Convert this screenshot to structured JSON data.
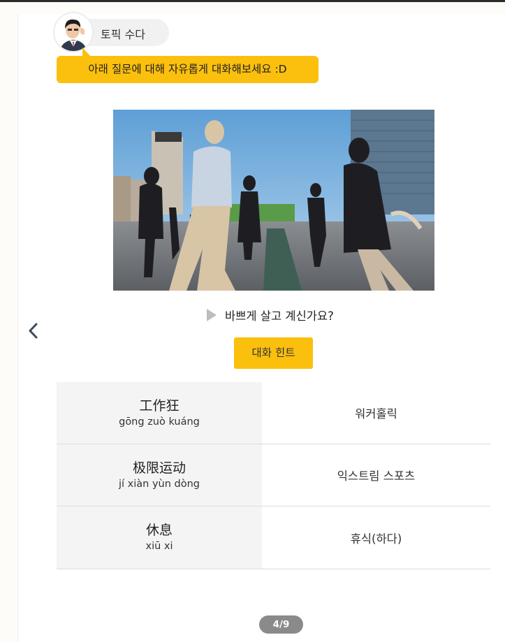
{
  "topic": {
    "label": "토픽 수다"
  },
  "bubble": {
    "text": "아래 질문에 대해 자유롭게 대화해보세요 :D"
  },
  "photo": {
    "description_icon": "photo-crowd-image"
  },
  "question": {
    "text": "바쁘게 살고 계신가요?"
  },
  "hint_button": {
    "label": "대화 힌트"
  },
  "vocabulary": [
    {
      "hanzi": "工作狂",
      "pinyin": "gōng zuò kuáng",
      "korean": "워커홀릭"
    },
    {
      "hanzi": "极限运动",
      "pinyin": "jí xiàn yùn dòng",
      "korean": "익스트림 스포츠"
    },
    {
      "hanzi": "休息",
      "pinyin": "xiū xi",
      "korean": "휴식(하다)"
    }
  ],
  "pager": {
    "text": "4/9"
  },
  "colors": {
    "accent": "#fbbf0d",
    "pill": "#f1f1f1",
    "pager": "#8a8a8a"
  }
}
